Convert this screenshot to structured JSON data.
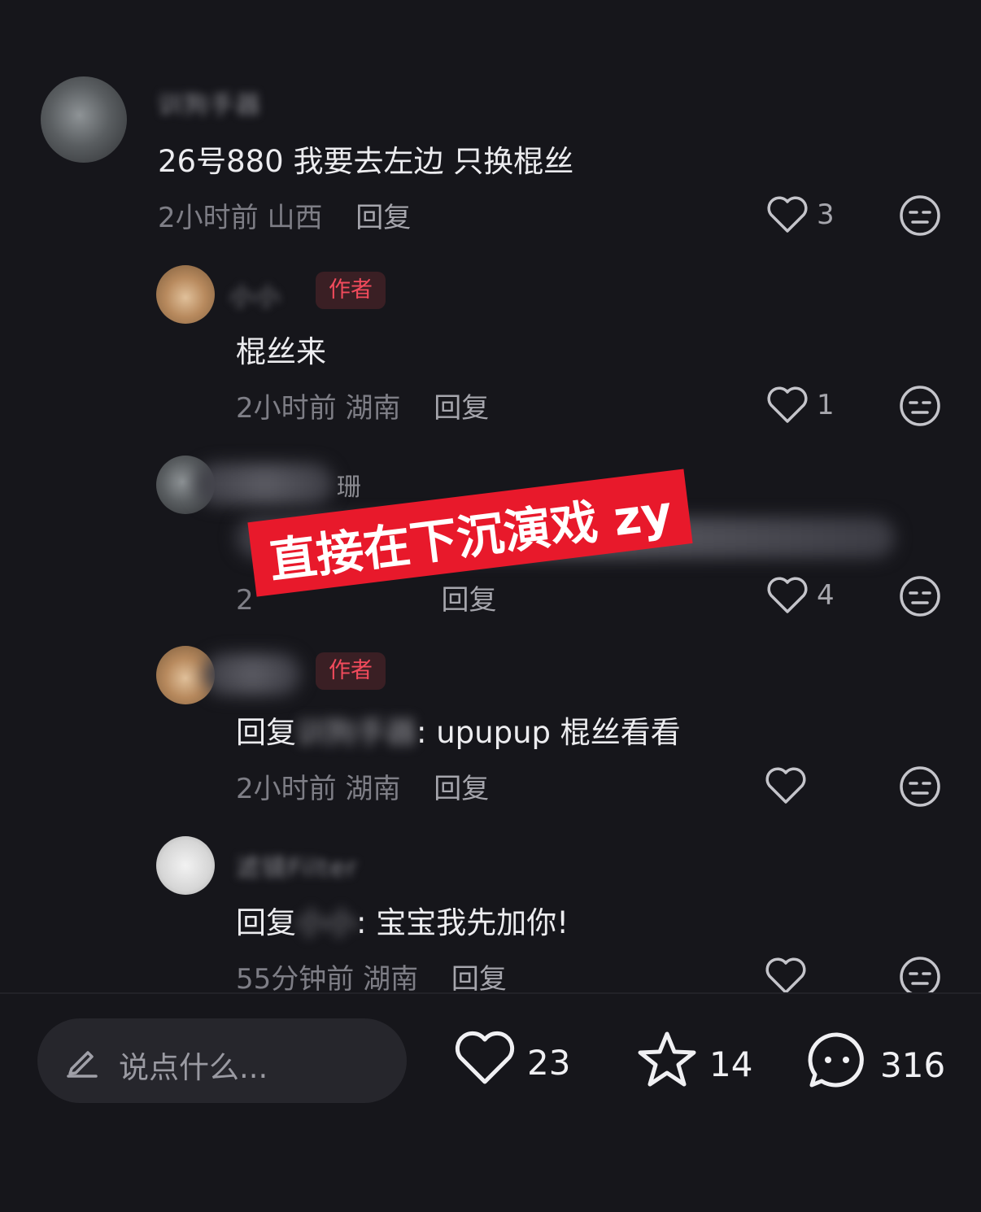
{
  "comments": [
    {
      "username": "训狗手器",
      "text": "26号880 我要去左边 只换棍丝",
      "time": "2小时前",
      "location": "山西",
      "reply_label": "回复",
      "likes": "3"
    },
    {
      "username": "小小",
      "author_tag": "作者",
      "text": "棍丝来",
      "time": "2小时前",
      "location": "湖南",
      "reply_label": "回复",
      "likes": "1"
    },
    {
      "username": "珊",
      "text": "",
      "time": "2",
      "location": "",
      "reply_label": "回复",
      "likes": "4"
    },
    {
      "username": "小小",
      "author_tag": "作者",
      "text_prefix": "回复",
      "text_blurred": "训狗手器",
      "text": ": upupup 棍丝看看",
      "time": "2小时前",
      "location": "湖南",
      "reply_label": "回复",
      "likes": ""
    },
    {
      "username": "滤镜Filter",
      "text_prefix": "回复",
      "text_blurred": "小小",
      "text": ": 宝宝我先加你!",
      "time": "55分钟前",
      "location": "湖南",
      "reply_label": "回复",
      "likes": ""
    }
  ],
  "overlay_banner": "直接在下沉演戏 zy",
  "bottom_bar": {
    "input_placeholder": "说点什么...",
    "likes": "23",
    "favorites": "14",
    "comments": "316"
  },
  "colors": {
    "background": "#16161b",
    "author_tag": "#f24b5c",
    "banner": "#e8192b"
  }
}
